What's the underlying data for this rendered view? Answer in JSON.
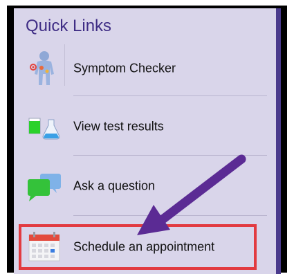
{
  "panel": {
    "title": "Quick Links"
  },
  "links": [
    {
      "label": "Symptom Checker",
      "icon": "body-scan-icon"
    },
    {
      "label": "View test results",
      "icon": "test-tubes-icon"
    },
    {
      "label": "Ask a question",
      "icon": "chat-bubbles-icon"
    },
    {
      "label": "Schedule an appointment",
      "icon": "calendar-icon"
    }
  ],
  "colors": {
    "title": "#3f2d85",
    "panel_bg": "#d9d5ea",
    "highlight": "#e23b41",
    "arrow": "#5b2b94"
  }
}
